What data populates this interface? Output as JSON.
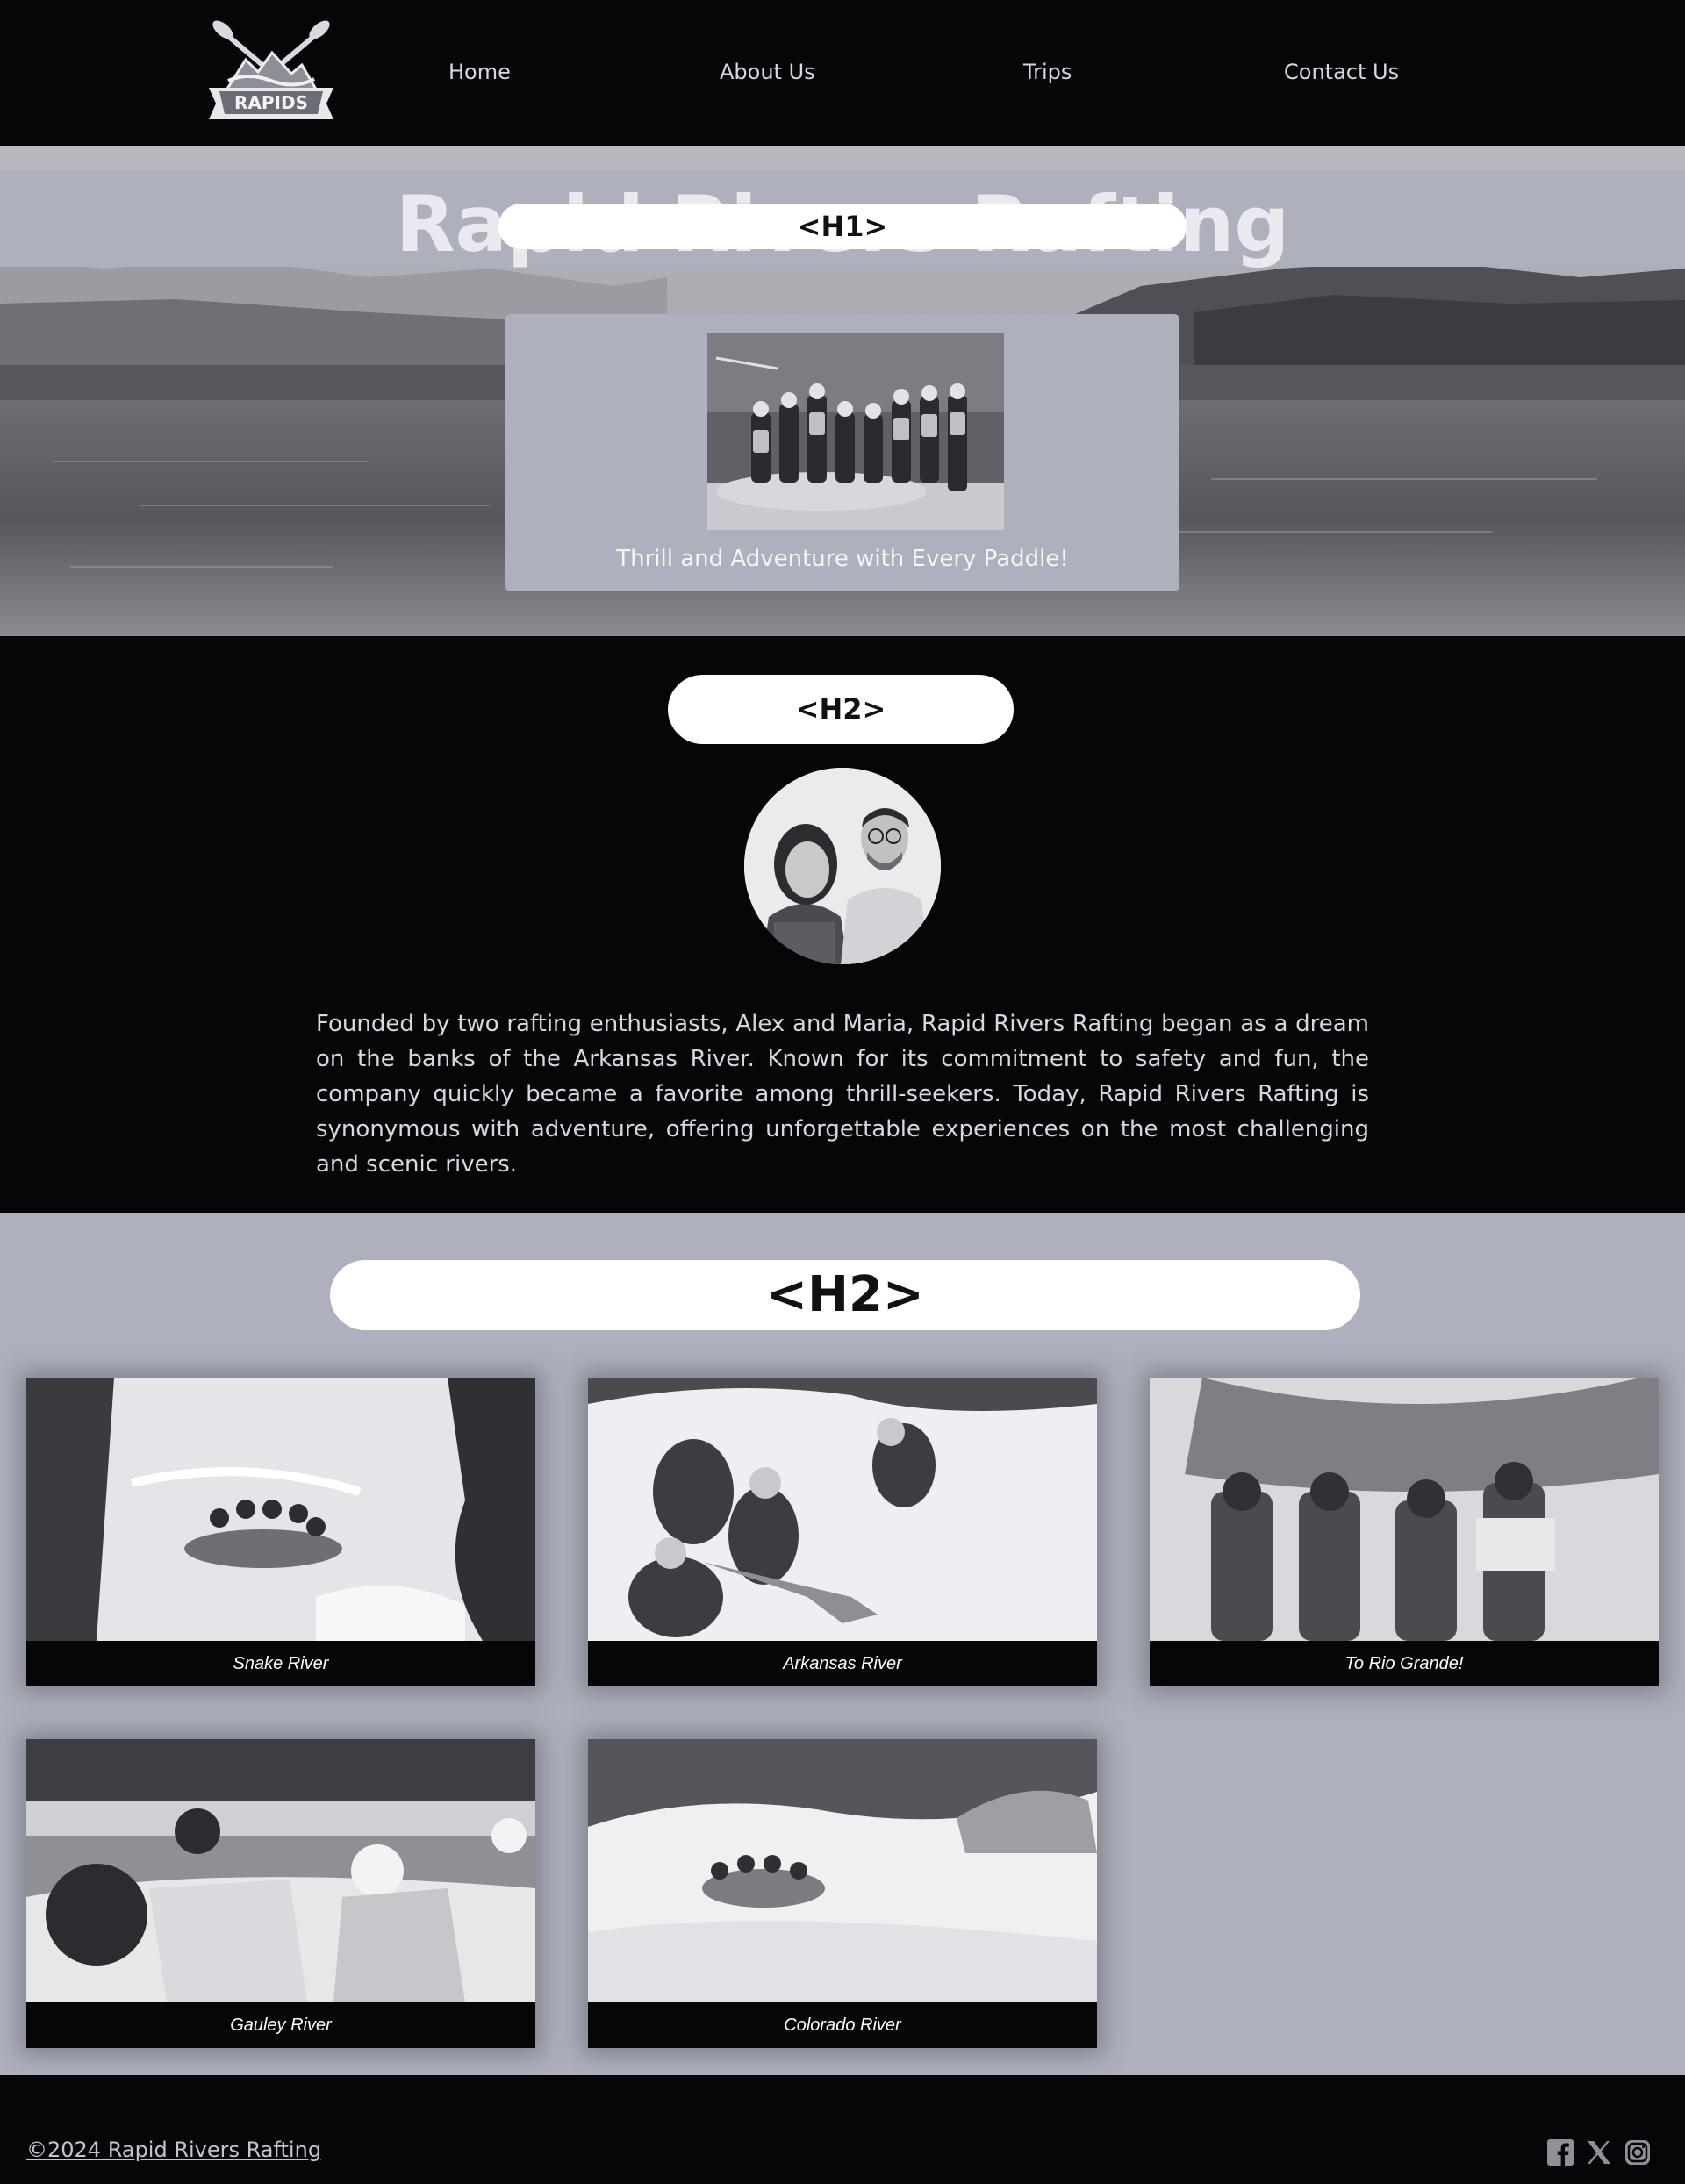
{
  "nav": {
    "logo_text": "RAPIDS",
    "links": [
      "Home",
      "About Us",
      "Trips",
      "Contact Us"
    ]
  },
  "hero": {
    "title": "Rapid Rivers Rafting",
    "title_tag": "<H1>",
    "caption": "Thrill and Adventure with Every Paddle!"
  },
  "about": {
    "heading_tag": "<H2>",
    "text": "Founded by two rafting enthusiasts, Alex and Maria, Rapid Rivers Rafting began as a dream on the banks of the Arkansas River. Known for its commitment to safety and fun, the company quickly became a favorite among thrill-seekers. Today, Rapid Rivers Rafting is synonymous with adventure, offering unforgettable experiences on the most challenging and scenic rivers."
  },
  "trips": {
    "heading_tag": "<H2>",
    "items": [
      {
        "caption": "Snake River"
      },
      {
        "caption": "Arkansas River"
      },
      {
        "caption": "To Rio Grande!"
      },
      {
        "caption": "Gauley River"
      },
      {
        "caption": "Colorado River"
      }
    ]
  },
  "footer": {
    "copyright": "©2024 Rapid Rivers Rafting",
    "social": [
      "facebook-icon",
      "x-icon",
      "instagram-icon"
    ]
  },
  "colors": {
    "background": "#060608",
    "band": "#aeb1bd",
    "text": "#d6d8e0",
    "tag_bg": "#ffffff"
  }
}
